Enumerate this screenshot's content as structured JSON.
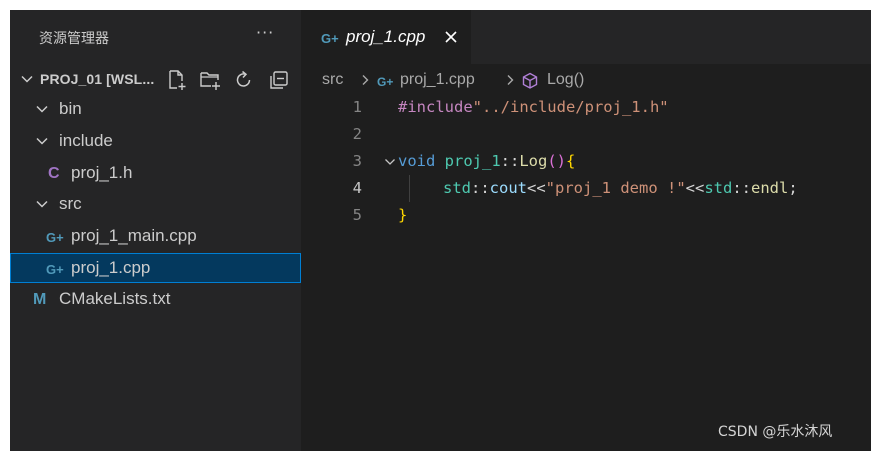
{
  "sidebar": {
    "title": "资源管理器",
    "more_icon": "ellipsis-icon",
    "section": {
      "title": "PROJ_01 [WSL...",
      "actions": [
        "new-file-icon",
        "new-folder-icon",
        "refresh-icon",
        "collapse-all-icon"
      ]
    },
    "tree": [
      {
        "label": "bin",
        "kind": "folder",
        "expanded": true
      },
      {
        "label": "include",
        "kind": "folder",
        "expanded": true
      },
      {
        "label": "proj_1.h",
        "kind": "file",
        "icon": "C"
      },
      {
        "label": "src",
        "kind": "folder",
        "expanded": true
      },
      {
        "label": "proj_1_main.cpp",
        "kind": "file",
        "icon": "G+"
      },
      {
        "label": "proj_1.cpp",
        "kind": "file",
        "icon": "G+",
        "selected": true
      },
      {
        "label": "CMakeLists.txt",
        "kind": "file",
        "icon": "M"
      }
    ]
  },
  "editor": {
    "tab": {
      "label": "proj_1.cpp",
      "icon": "G+"
    },
    "breadcrumb": {
      "folder": "src",
      "file": "proj_1.cpp",
      "symbol": "Log()"
    },
    "lines": [
      {
        "n": "1"
      },
      {
        "n": "2"
      },
      {
        "n": "3"
      },
      {
        "n": "4"
      },
      {
        "n": "5"
      }
    ],
    "code": {
      "l1_directive": "#include",
      "l1_path": "\"../include/proj_1.h\"",
      "l3_void": "void",
      "l3_class": "proj_1",
      "l3_scope": "::",
      "l3_fn": "Log",
      "l3_paren": "()",
      "l3_brace": "{",
      "l4_std1": "std",
      "l4_scope1": "::",
      "l4_cout": "cout",
      "l4_op1": "<<",
      "l4_str": "\"proj_1 demo !\"",
      "l4_op2": "<<",
      "l4_std2": "std",
      "l4_scope2": "::",
      "l4_endl": "endl",
      "l4_semi": ";",
      "l5_brace": "}"
    }
  },
  "watermark": "CSDN @乐水沐风",
  "colors": {
    "sidebar_bg": "#252526",
    "editor_bg": "#1e1e1e",
    "selection_bg": "#04395e",
    "selection_border": "#007fd4",
    "cpp_icon": "#519aba",
    "c_icon": "#a074c4"
  }
}
